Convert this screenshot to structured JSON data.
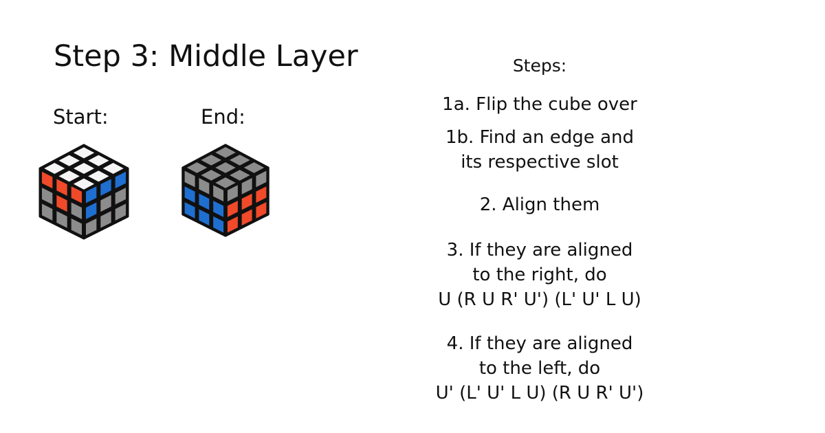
{
  "slide": {
    "title": "Step 3: Middle Layer",
    "start_label": "Start:",
    "end_label": "End:"
  },
  "cubes": {
    "start": {
      "top": [
        [
          "#f5f5f5",
          "#f5f5f5",
          "#f5f5f5"
        ],
        [
          "#f5f5f5",
          "#f5f5f5",
          "#f5f5f5"
        ],
        [
          "#f5f5f5",
          "#f5f5f5",
          "#f5f5f5"
        ]
      ],
      "left": [
        [
          "#f04a2a",
          "#f04a2a",
          "#f04a2a"
        ],
        [
          "#8c8c8c",
          "#f04a2a",
          "#8c8c8c"
        ],
        [
          "#8c8c8c",
          "#8c8c8c",
          "#8c8c8c"
        ]
      ],
      "right": [
        [
          "#1f6fd1",
          "#1f6fd1",
          "#1f6fd1"
        ],
        [
          "#1f6fd1",
          "#8c8c8c",
          "#8c8c8c"
        ],
        [
          "#8c8c8c",
          "#8c8c8c",
          "#8c8c8c"
        ]
      ]
    },
    "end": {
      "top": [
        [
          "#8c8c8c",
          "#8c8c8c",
          "#8c8c8c"
        ],
        [
          "#8c8c8c",
          "#8c8c8c",
          "#8c8c8c"
        ],
        [
          "#8c8c8c",
          "#8c8c8c",
          "#8c8c8c"
        ]
      ],
      "left": [
        [
          "#8c8c8c",
          "#8c8c8c",
          "#8c8c8c"
        ],
        [
          "#1f6fd1",
          "#1f6fd1",
          "#1f6fd1"
        ],
        [
          "#1f6fd1",
          "#1f6fd1",
          "#1f6fd1"
        ]
      ],
      "right": [
        [
          "#8c8c8c",
          "#8c8c8c",
          "#8c8c8c"
        ],
        [
          "#f04a2a",
          "#f04a2a",
          "#f04a2a"
        ],
        [
          "#f04a2a",
          "#f04a2a",
          "#f04a2a"
        ]
      ]
    }
  },
  "steps": {
    "heading": "Steps:",
    "items": [
      {
        "lines": [
          "1a. Flip the cube over"
        ]
      },
      {
        "lines": [
          "1b. Find an edge and",
          "its respective slot"
        ]
      },
      {
        "lines": [
          "2. Align them"
        ]
      },
      {
        "lines": [
          "3. If they are aligned",
          "to the right, do",
          "U (R U R' U') (L' U' L U)"
        ]
      },
      {
        "lines": [
          "4. If they are aligned",
          "to the left, do",
          "U' (L' U' L U) (R U R' U')"
        ]
      }
    ]
  }
}
